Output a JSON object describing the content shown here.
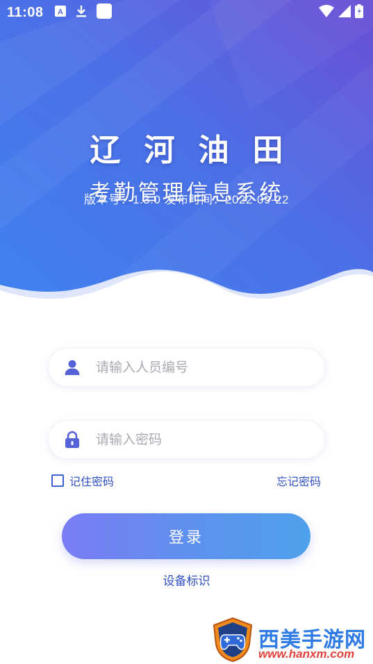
{
  "status_bar": {
    "time": "11:08",
    "left_icons": [
      "accessibility-icon",
      "download-icon",
      "app-icon"
    ],
    "right_icons": [
      "wifi-icon",
      "signal-icon",
      "battery-icon"
    ]
  },
  "header": {
    "title": "辽河油田",
    "subtitle": "考勤管理信息系统",
    "version_line": "版本号：1.3.0 发布时间：2022-09-22"
  },
  "form": {
    "username_placeholder": "请输入人员编号",
    "password_placeholder": "请输入密码",
    "remember_label": "记住密码",
    "forgot_label": "忘记密码",
    "login_label": "登录",
    "device_label": "设备标识"
  },
  "watermark": {
    "title": "西美手游网",
    "url": "www.hanxm.com"
  },
  "colors": {
    "hero_gradient_start": "#6a5ad6",
    "hero_gradient_end": "#3f83f0",
    "link_blue": "#2f4fc4",
    "button_gradient_start": "#7a7cf3",
    "button_gradient_end": "#4ea0ec",
    "icon_purple": "#5561d6"
  }
}
